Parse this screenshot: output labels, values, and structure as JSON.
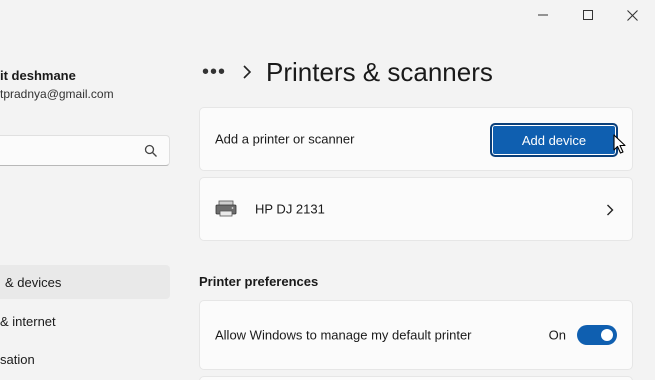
{
  "window": {
    "controls": [
      "minimize-icon",
      "maximize-icon",
      "close-icon"
    ]
  },
  "sidebar": {
    "user_name": "it deshmane",
    "user_email": "tpradnya@gmail.com",
    "search": {
      "value": "",
      "placeholder": ""
    },
    "items": [
      {
        "label": "& devices",
        "active": true
      },
      {
        "label": "& internet",
        "active": false
      },
      {
        "label": "sation",
        "active": false
      }
    ]
  },
  "main": {
    "breadcrumb_more": "•••",
    "title": "Printers & scanners",
    "add_row": {
      "label": "Add a printer or scanner",
      "button": "Add device"
    },
    "printer": {
      "name": "HP DJ 2131"
    },
    "preferences": {
      "header": "Printer preferences",
      "default_printer": {
        "label": "Allow Windows to manage my default printer",
        "state_label": "On",
        "on": true
      }
    }
  },
  "colors": {
    "accent": "#0f5fb0",
    "background": "#f3f3f3",
    "card": "#fbfbfb"
  }
}
